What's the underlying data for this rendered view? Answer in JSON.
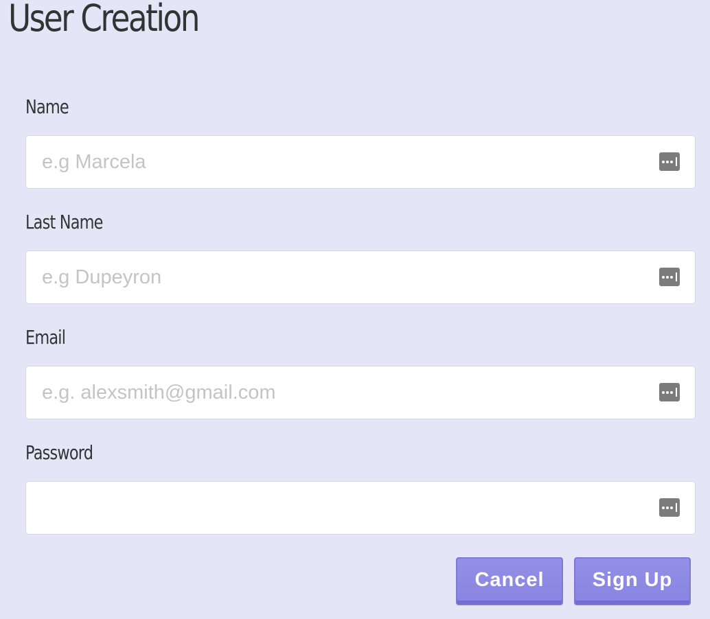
{
  "page": {
    "title": "User Creation"
  },
  "form": {
    "fields": [
      {
        "label": "Name",
        "placeholder": "e.g Marcela",
        "value": "",
        "type": "text",
        "icon": "keychain-autofill-icon"
      },
      {
        "label": "Last Name",
        "placeholder": "e.g Dupeyron",
        "value": "",
        "type": "text",
        "icon": "keychain-autofill-icon"
      },
      {
        "label": "Email",
        "placeholder": "e.g. alexsmith@gmail.com",
        "value": "",
        "type": "email",
        "icon": "keychain-autofill-icon"
      },
      {
        "label": "Password",
        "placeholder": "",
        "value": "",
        "type": "password",
        "icon": "keychain-autofill-icon"
      }
    ],
    "actions": {
      "cancel_label": "Cancel",
      "signup_label": "Sign Up"
    }
  },
  "colors": {
    "background": "#e6e5f7",
    "button": "#8d8ae3",
    "button_border": "#7b7ad8",
    "text": "#333333",
    "placeholder": "#c4c4c4"
  }
}
